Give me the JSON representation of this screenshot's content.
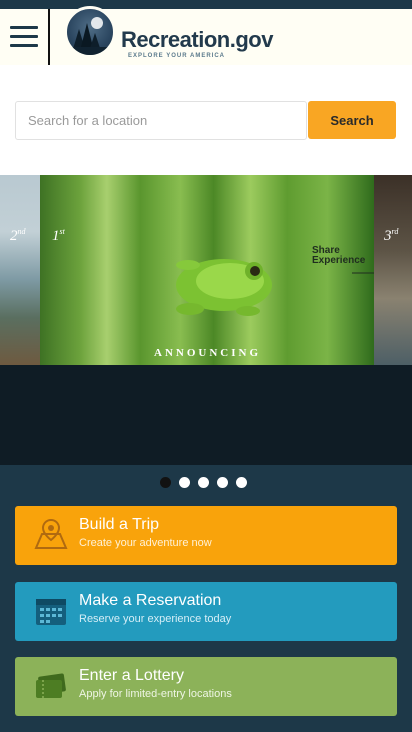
{
  "header": {
    "menu_icon": "hamburger-menu-icon",
    "logo_icon": "recreation-logo-badge",
    "site_title": "Recreation.gov",
    "tagline": "EXPLORE YOUR AMERICA"
  },
  "search": {
    "placeholder": "Search for a location",
    "value": "",
    "button_label": "Search"
  },
  "carousel": {
    "left_rank": "2",
    "left_rank_suffix": "nd",
    "main_rank": "1",
    "main_rank_suffix": "st",
    "right_rank": "3",
    "right_rank_suffix": "rd",
    "share_line1": "Share",
    "share_line2": "Experience",
    "caption": "ANNOUNCING",
    "slide_count": 5,
    "active_index": 0
  },
  "actions": [
    {
      "title": "Build a Trip",
      "subtitle": "Create your adventure now",
      "icon": "map-pin-icon"
    },
    {
      "title": "Make a Reservation",
      "subtitle": "Reserve your experience today",
      "icon": "calendar-icon"
    },
    {
      "title": "Enter a Lottery",
      "subtitle": "Apply for limited-entry locations",
      "icon": "ticket-icon"
    }
  ],
  "colors": {
    "navy": "#1d3848",
    "search_button": "#f9a623",
    "build_trip": "#f9a30b",
    "reservation": "#239bbe",
    "lottery": "#8cb259"
  }
}
